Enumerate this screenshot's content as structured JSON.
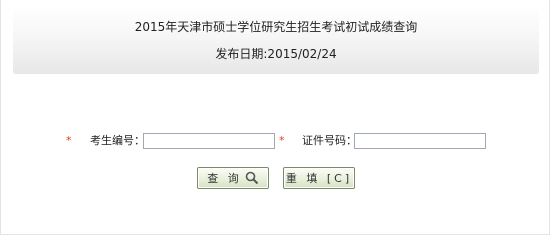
{
  "header": {
    "title": "2015年天津市硕士学位研究生招生考试初试成绩查询",
    "date_line": "发布日期:2015/02/24"
  },
  "form": {
    "required_mark": "*",
    "exam_no_label": "考生编号：",
    "exam_no_value": "",
    "id_no_label": "证件号码：",
    "id_no_value": ""
  },
  "buttons": {
    "query_label": "查 询",
    "reset_label": "重 填 [C]"
  },
  "icons": {
    "query_icon": "search-icon"
  },
  "colors": {
    "required": "#e23a1d",
    "button_border": "#7d8a6a"
  }
}
